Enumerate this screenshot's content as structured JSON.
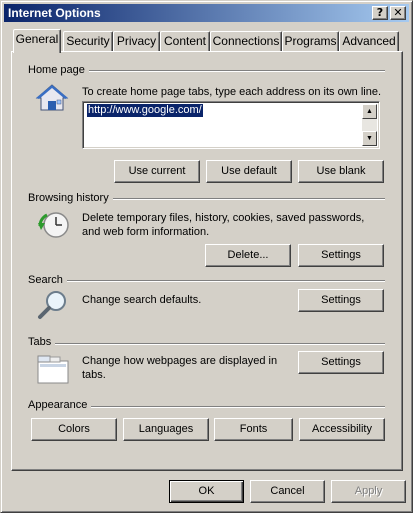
{
  "window": {
    "title": "Internet Options",
    "help_label": "?",
    "close_label": "✕"
  },
  "tabs": [
    {
      "label": "General",
      "active": true
    },
    {
      "label": "Security"
    },
    {
      "label": "Privacy"
    },
    {
      "label": "Content"
    },
    {
      "label": "Connections"
    },
    {
      "label": "Programs"
    },
    {
      "label": "Advanced"
    }
  ],
  "home_page": {
    "label": "Home page",
    "description": "To create home page tabs, type each address on its own line.",
    "url": "http://www.google.com/",
    "buttons": {
      "use_current": "Use current",
      "use_default": "Use default",
      "use_blank": "Use blank"
    }
  },
  "browsing_history": {
    "label": "Browsing history",
    "description_line1": "Delete temporary files, history, cookies, saved passwords,",
    "description_line2": "and web form information.",
    "delete_label": "Delete...",
    "settings_label": "Settings"
  },
  "search": {
    "label": "Search",
    "description": "Change search defaults.",
    "settings_label": "Settings"
  },
  "tabs_section": {
    "label": "Tabs",
    "description_line1": "Change how webpages are displayed in",
    "description_line2": "tabs.",
    "settings_label": "Settings"
  },
  "appearance": {
    "label": "Appearance",
    "buttons": {
      "colors": "Colors",
      "languages": "Languages",
      "fonts": "Fonts",
      "accessibility": "Accessibility"
    }
  },
  "footer": {
    "ok_label": "OK",
    "cancel_label": "Cancel",
    "apply_label": "Apply"
  }
}
